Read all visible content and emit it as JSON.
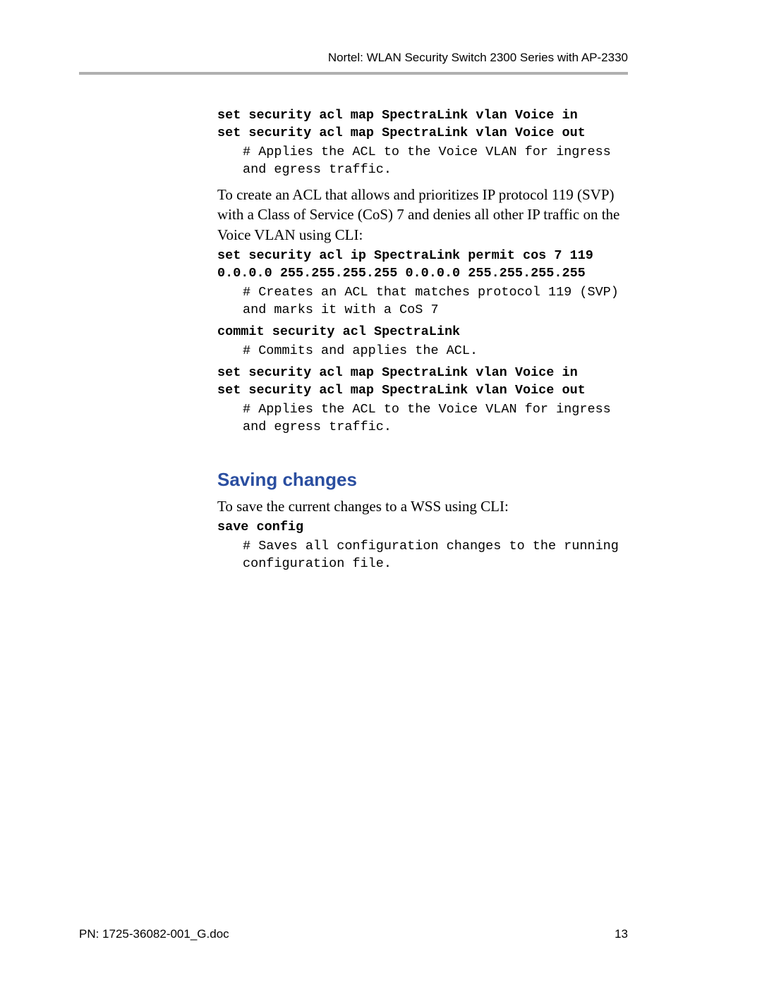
{
  "header": {
    "title": "Nortel: WLAN Security Switch 2300 Series with AP-2330"
  },
  "block1": {
    "cmd1": "set security acl map SpectraLink vlan Voice in",
    "cmd2": "set security acl map SpectraLink vlan Voice out",
    "comment": "# Applies the ACL to the Voice VLAN for ingress and egress traffic."
  },
  "para1": "To create an ACL that allows and prioritizes IP protocol 119 (SVP) with a Class of Service (CoS) 7 and denies all other IP traffic on the Voice VLAN using CLI:",
  "block2": {
    "cmd1": "set security acl ip SpectraLink permit cos 7 119 0.0.0.0 255.255.255.255 0.0.0.0 255.255.255.255",
    "comment1": "# Creates an ACL that matches protocol 119 (SVP) and marks it with a CoS 7",
    "cmd2": "commit security acl SpectraLink",
    "comment2": "# Commits and applies the ACL.",
    "cmd3": "set security acl map SpectraLink vlan Voice in",
    "cmd4": "set security acl map SpectraLink vlan Voice out",
    "comment3": "# Applies the ACL to the Voice VLAN for ingress and egress traffic."
  },
  "section": {
    "heading": "Saving changes",
    "para": "To save the current changes to a WSS using CLI:",
    "cmd": "save config",
    "comment": "# Saves all configuration changes to the running configuration file."
  },
  "footer": {
    "doc": "PN: 1725-36082-001_G.doc",
    "page": "13"
  }
}
